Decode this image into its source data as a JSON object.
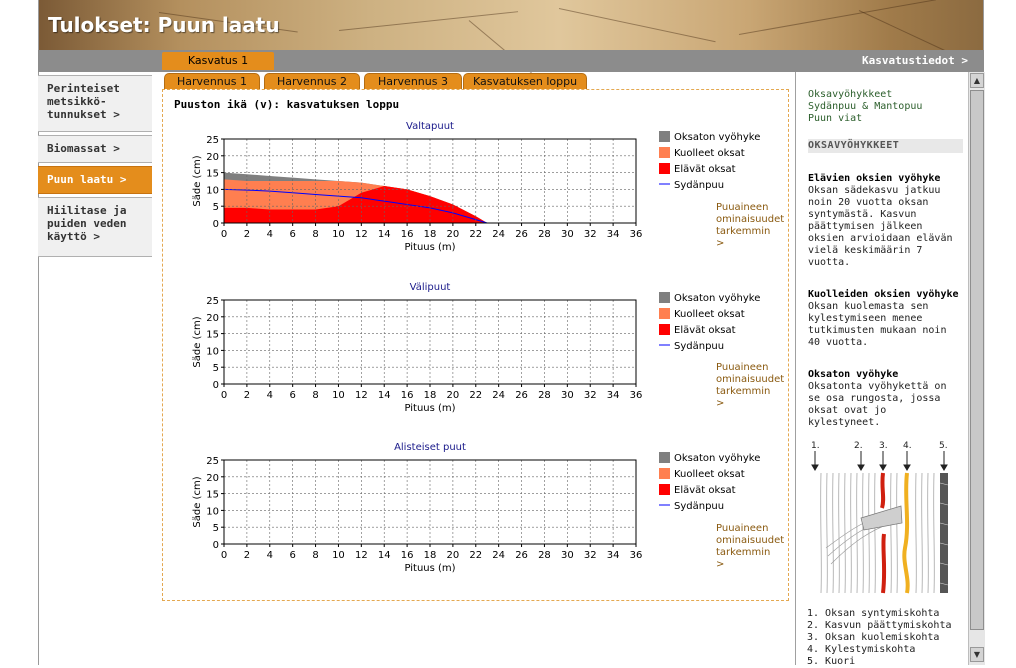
{
  "header": {
    "title": "Tulokset: Puun laatu"
  },
  "nav": {
    "growth_tab": "Kasvatus 1",
    "info_link": "Kasvatustiedot >"
  },
  "sidebar": {
    "items": [
      {
        "label": "Perinteiset metsikkö-tunnukset >",
        "active": false
      },
      {
        "label": "Biomassat >",
        "active": false
      },
      {
        "label": "Puun laatu >",
        "active": true
      },
      {
        "label": "Hiilitase ja puiden veden käyttö >",
        "active": false
      }
    ]
  },
  "subtabs": [
    "Harvennus 1",
    "Harvennus 2",
    "Harvennus 3",
    "Kasvatuksen loppu"
  ],
  "main": {
    "heading": "Puuston ikä (v):  kasvatuksen loppu"
  },
  "more_link": "Puuaineen ominaisuudet tarkemmin >",
  "legend": [
    "Oksaton vyöhyke",
    "Kuolleet oksat",
    "Elävät oksat",
    "Sydänpuu"
  ],
  "colors": {
    "oksaton": "#7f7f7f",
    "kuolleet": "#ff7f50",
    "elavat": "#ff0000",
    "sydanpuu": "#0000ff",
    "accent": "#e48d1c"
  },
  "chart_data": [
    {
      "type": "area",
      "title": "Valtapuut",
      "xlabel": "Pituus (m)",
      "ylabel": "Säde (cm)",
      "xlim": [
        0,
        36
      ],
      "ylim": [
        0,
        25
      ],
      "xticks": [
        0,
        2,
        4,
        6,
        8,
        10,
        12,
        14,
        16,
        18,
        20,
        22,
        24,
        26,
        28,
        30,
        32,
        34,
        36
      ],
      "yticks": [
        0,
        5,
        10,
        15,
        20,
        25
      ],
      "grid": true,
      "x": [
        0,
        2,
        4,
        6,
        8,
        10,
        12,
        14,
        16,
        18,
        20,
        22,
        23
      ],
      "series": [
        {
          "name": "Oksaton vyöhyke",
          "values": [
            15,
            14.5,
            14,
            13.5,
            13,
            12.5,
            12,
            11,
            10,
            8,
            5.5,
            2,
            0
          ]
        },
        {
          "name": "Kuolleet oksat",
          "values": [
            13,
            12.5,
            12.5,
            12.5,
            12.5,
            12.5,
            12,
            11,
            10,
            8,
            5.5,
            2,
            0
          ]
        },
        {
          "name": "Elävät oksat",
          "values": [
            4.5,
            4.5,
            4,
            4,
            4,
            5,
            9,
            11,
            10,
            8,
            5.5,
            2,
            0
          ]
        },
        {
          "name": "Sydänpuu",
          "values": [
            10,
            9.8,
            9.5,
            9,
            8.5,
            8,
            7.5,
            6.5,
            5.5,
            4.5,
            3,
            1,
            0
          ]
        }
      ],
      "legend_position": "right"
    },
    {
      "type": "area",
      "title": "Välipuut",
      "xlabel": "Pituus (m)",
      "ylabel": "Säde (cm)",
      "xlim": [
        0,
        36
      ],
      "ylim": [
        0,
        25
      ],
      "xticks": [
        0,
        2,
        4,
        6,
        8,
        10,
        12,
        14,
        16,
        18,
        20,
        22,
        24,
        26,
        28,
        30,
        32,
        34,
        36
      ],
      "yticks": [
        0,
        5,
        10,
        15,
        20,
        25
      ],
      "grid": true,
      "series": [],
      "legend_position": "right"
    },
    {
      "type": "area",
      "title": "Alisteiset puut",
      "xlabel": "Pituus (m)",
      "ylabel": "Säde (cm)",
      "xlim": [
        0,
        36
      ],
      "ylim": [
        0,
        25
      ],
      "xticks": [
        0,
        2,
        4,
        6,
        8,
        10,
        12,
        14,
        16,
        18,
        20,
        22,
        24,
        26,
        28,
        30,
        32,
        34,
        36
      ],
      "yticks": [
        0,
        5,
        10,
        15,
        20,
        25
      ],
      "grid": true,
      "series": [],
      "legend_position": "right"
    }
  ],
  "right_panel": {
    "links": [
      "Oksavyöhykkeet",
      "Sydänpuu & Mantopuu",
      "Puun viat"
    ],
    "section_title": "Oksavyöhykkeet",
    "sections": [
      {
        "heading": "Elävien oksien vyöhyke",
        "text": "Oksan sädekasvu jatkuu noin 20 vuotta oksan syntymästä. Kasvun päättymisen jälkeen oksien arvioidaan elävän vielä keskimäärin 7 vuotta."
      },
      {
        "heading": "Kuolleiden oksien vyöhyke",
        "text": "Oksan kuolemasta sen kylestymiseen menee tutkimusten mukaan noin 40 vuotta."
      },
      {
        "heading": "Oksaton vyöhyke",
        "text": "Oksatonta vyöhykettä on se osa rungosta, jossa oksat ovat jo kylestyneet."
      }
    ],
    "diagram_numbers": [
      "1.",
      "2.",
      "3.",
      "4.",
      "5."
    ],
    "diagram_legend": [
      "1. Oksan syntymiskohta",
      "2. Kasvun päättymiskohta",
      "3. Oksan kuolemiskohta",
      "4. Kylestymiskohta",
      "5. Kuori"
    ]
  }
}
